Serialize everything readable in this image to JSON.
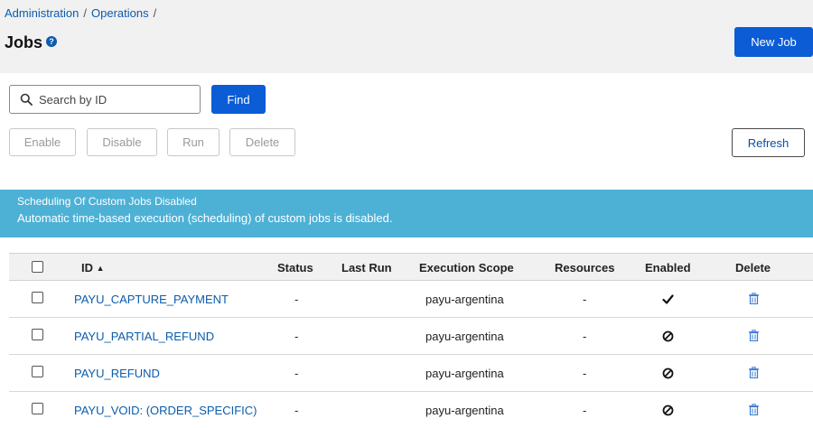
{
  "breadcrumb": {
    "items": [
      "Administration",
      "Operations"
    ],
    "separator": "/"
  },
  "page": {
    "title": "Jobs",
    "help_icon": "?"
  },
  "toolbar": {
    "new_job": "New Job",
    "find": "Find",
    "enable": "Enable",
    "disable": "Disable",
    "run": "Run",
    "delete": "Delete",
    "refresh": "Refresh"
  },
  "search": {
    "placeholder": "Search by ID",
    "value": ""
  },
  "banner": {
    "title": "Scheduling Of Custom Jobs Disabled",
    "message": "Automatic time-based execution (scheduling) of custom jobs is disabled.",
    "color": "#4db1d6"
  },
  "table": {
    "columns": {
      "id": "ID",
      "sort_indicator": "▲",
      "status": "Status",
      "last_run": "Last Run",
      "execution_scope": "Execution Scope",
      "resources": "Resources",
      "enabled": "Enabled",
      "delete": "Delete"
    },
    "rows": [
      {
        "id": "PAYU_CAPTURE_PAYMENT",
        "status": "-",
        "last_run": "",
        "execution_scope": "payu-argentina",
        "resources": "-",
        "enabled_icon": "checkmark-icon",
        "enabled": true
      },
      {
        "id": "PAYU_PARTIAL_REFUND",
        "status": "-",
        "last_run": "",
        "execution_scope": "payu-argentina",
        "resources": "-",
        "enabled_icon": "disabled-icon",
        "enabled": false
      },
      {
        "id": "PAYU_REFUND",
        "status": "-",
        "last_run": "",
        "execution_scope": "payu-argentina",
        "resources": "-",
        "enabled_icon": "disabled-icon",
        "enabled": false
      },
      {
        "id": "PAYU_VOID: (ORDER_SPECIFIC)",
        "status": "-",
        "last_run": "",
        "execution_scope": "payu-argentina",
        "resources": "-",
        "enabled_icon": "disabled-icon",
        "enabled": false
      }
    ]
  },
  "colors": {
    "primary": "#0b5cd5",
    "link": "#0b5cad"
  }
}
